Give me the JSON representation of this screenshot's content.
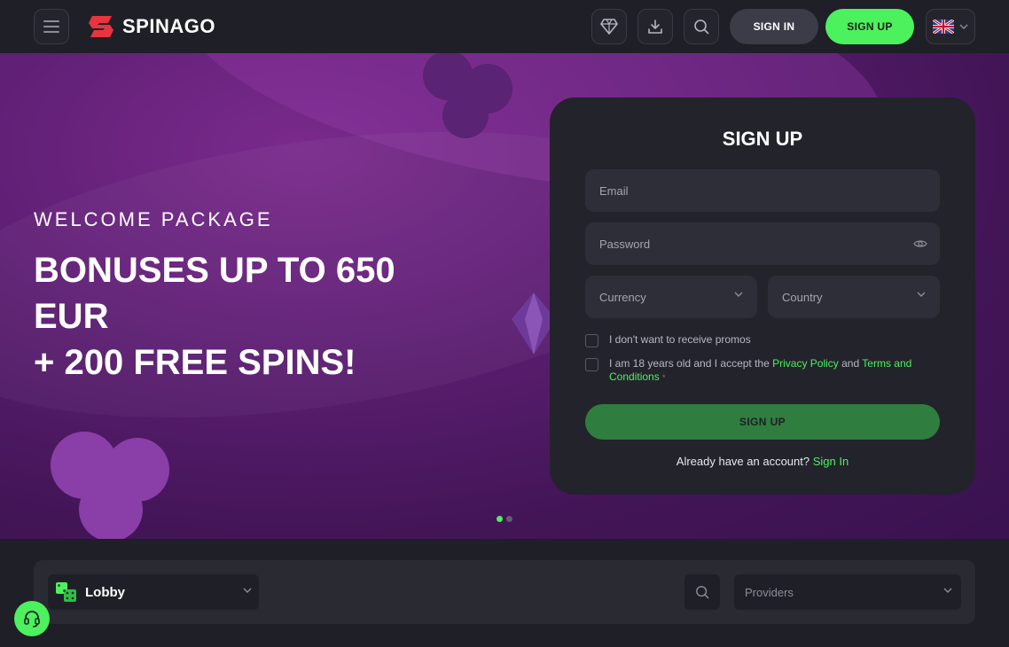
{
  "header": {
    "logo_text": "SPINAGO",
    "signin_label": "SIGN IN",
    "signup_label": "SIGN UP",
    "icons": [
      "menu-icon",
      "diamond-icon",
      "download-icon",
      "search-icon",
      "uk-flag-icon",
      "chevron-down-icon"
    ]
  },
  "hero": {
    "subtitle": "WELCOME PACKAGE",
    "title_line1": "BONUSES UP TO 650",
    "title_line2": "EUR",
    "title_line3": "+ 200 FREE SPINS!",
    "slides_total": 2,
    "slide_active": 1
  },
  "signup_form": {
    "title": "SIGN UP",
    "email_placeholder": "Email",
    "password_placeholder": "Password",
    "currency_placeholder": "Currency",
    "country_placeholder": "Country",
    "promo_checkbox": "I don't want to receive promos",
    "age_text_1": "I am 18 years old and I accept the ",
    "privacy_link": "Privacy Policy",
    "age_text_2": " and ",
    "terms_link": "Terms and Conditions",
    "required_mark": "*",
    "submit_label": "SIGN UP",
    "already_text": "Already have an account? ",
    "signin_link": "Sign In"
  },
  "filter_bar": {
    "lobby_label": "Lobby",
    "providers_placeholder": "Providers"
  },
  "colors": {
    "accent": "#4cf15e",
    "background": "#1f1f27",
    "card": "#23232b",
    "hero_purple": "#5e1f74",
    "signup_button": "#2f7d3f",
    "logo_red": "#e8343f"
  }
}
